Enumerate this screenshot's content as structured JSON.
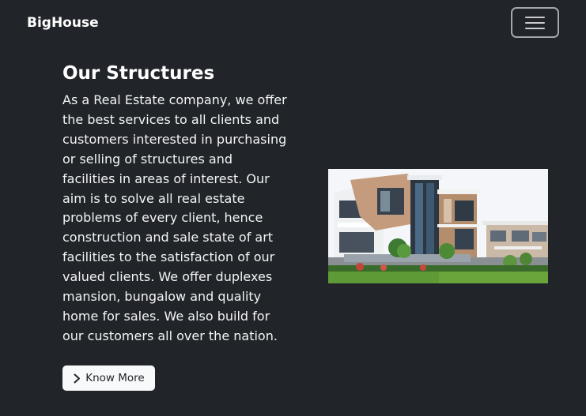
{
  "navbar": {
    "brand": "BigHouse",
    "toggler_icon": "hamburger-menu-icon"
  },
  "section": {
    "title": "Our Structures",
    "description": "As a Real Estate company, we offer the best services to all clients and customers interested in purchasing or selling of structures and facilities in areas of interest. Our aim is to solve all real estate problems of every client, hence construction and sale state of art facilities to the satisfaction of our valued clients. We offer duplexes mansion, bungalow and quality home for sales. We also build for our customers all over the nation.",
    "button_label": "Know More",
    "button_icon": "chevron-right-icon",
    "image_subject": "modern-house-photo"
  },
  "colors": {
    "background": "#212529",
    "text": "#ffffff",
    "button_bg": "#f8f9fa",
    "button_text": "#212529",
    "toggler_border": "#a3a6aa"
  }
}
